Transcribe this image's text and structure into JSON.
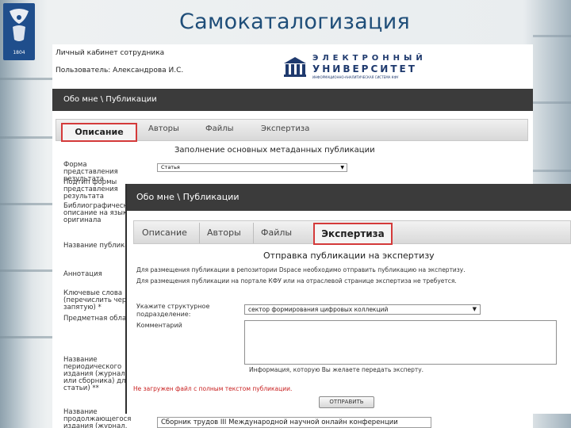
{
  "slide": {
    "title": "Самокаталогизация",
    "logo_year": "1804"
  },
  "back": {
    "staff_cabinet": "Личный кабинет сотрудника",
    "user": "Пользователь: Александрова И.С.",
    "eu_logo": {
      "line1": "ЭЛЕКТРОННЫЙ",
      "line2": "УНИВЕРСИТЕТ",
      "line3": "ИНФОРМАЦИОННО-АНАЛИТИЧЕСКАЯ СИСТЕМА КФУ"
    },
    "breadcrumb": "Обо мне \\ Публикации",
    "tabs": [
      "Описание",
      "Авторы",
      "Файлы",
      "Экспертиза"
    ],
    "active_tab": "Описание",
    "heading": "Заполнение основных метаданных публикации",
    "fields": {
      "form": "Форма представления результата",
      "subtype": "Подтип формы представления результата",
      "biblio": "Библиографическое описание на языке оригинала",
      "name": "Название публикации",
      "annotation": "Аннотация",
      "keywords": "Ключевые слова (перечислить через запятую) *",
      "subject": "Предметная область",
      "periodical": "Название периодического издания (журнала или сборника) для статьи) **",
      "continuing": "Название продолжающегося издания (журнал, сборник)"
    },
    "form_value": "Статья",
    "bottom_value": "Сборник трудов III Международной научной онлайн конференции"
  },
  "front": {
    "breadcrumb": "Обо мне \\ Публикации",
    "tabs": [
      "Описание",
      "Авторы",
      "Файлы",
      "Экспертиза"
    ],
    "active_tab": "Экспертиза",
    "heading": "Отправка публикации на экспертизу",
    "info1": "Для размещения публикации в репозитории Dspace необходимо отправить публикацию на экспертизу.",
    "info2": "Для размещения публикации на портале КФУ или на отраслевой странице экспертиза не требуется.",
    "unit_label": "Укажите структурное подразделение:",
    "unit_value": "сектор формирования цифровых коллекций",
    "comment_label": "Комментарий",
    "hint": "Информация, которую Вы желаете передать эксперту.",
    "error": "Не загружен файл с полным текстом публикации.",
    "submit": "ОТПРАВИТЬ"
  },
  "colors": {
    "title": "#1f4e79",
    "dark_bar": "#3b3b3b",
    "highlight": "#d43a3a",
    "error": "#c81e1e",
    "eu_brand": "#1f3a6e"
  }
}
